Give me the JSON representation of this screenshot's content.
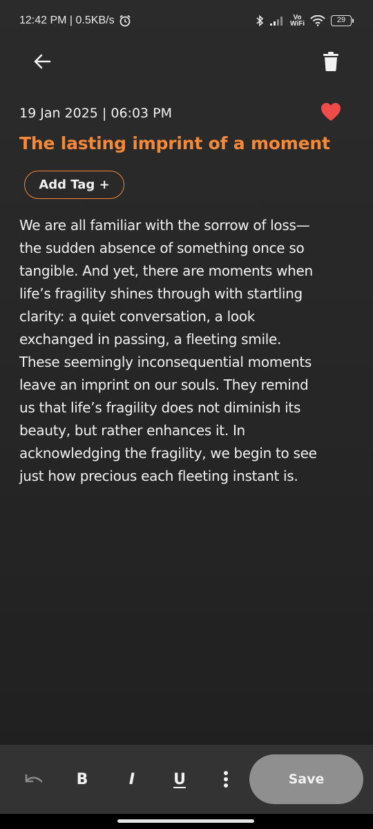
{
  "status_bar": {
    "time_speed": "12:42 PM | 0.5KB/s",
    "vowifi_top": "Vo",
    "vowifi_bottom": "WiFi",
    "battery": "29"
  },
  "note": {
    "date": "19 Jan 2025 | 06:03 PM",
    "title": "The lasting imprint of a moment",
    "add_tag_label": "Add Tag +",
    "body": "We are all familiar with the sorrow of loss—\nthe sudden absence of something once so\ntangible. And yet, there are moments when\nlife’s fragility shines through with startling\nclarity: a quiet conversation, a look\nexchanged in passing, a fleeting smile.\nThese seemingly inconsequential moments\nleave an imprint on our souls. They remind\nus that life’s fragility does not diminish its\nbeauty, but rather enhances it. In\nacknowledging the fragility, we begin to see\njust how precious each fleeting instant is.",
    "favorite": true
  },
  "toolbar": {
    "bold_label": "B",
    "italic_label": "I",
    "underline_label": "U",
    "save_label": "Save"
  },
  "icons": {
    "back": "arrow-left-icon",
    "delete": "trash-icon",
    "favorite": "heart-icon",
    "undo": "undo-icon",
    "more": "more-vertical-icon"
  },
  "colors": {
    "accent": "#f5893a",
    "heart": "#ef4b4b",
    "save_button": "#8f8f8f",
    "background": "#262626"
  }
}
